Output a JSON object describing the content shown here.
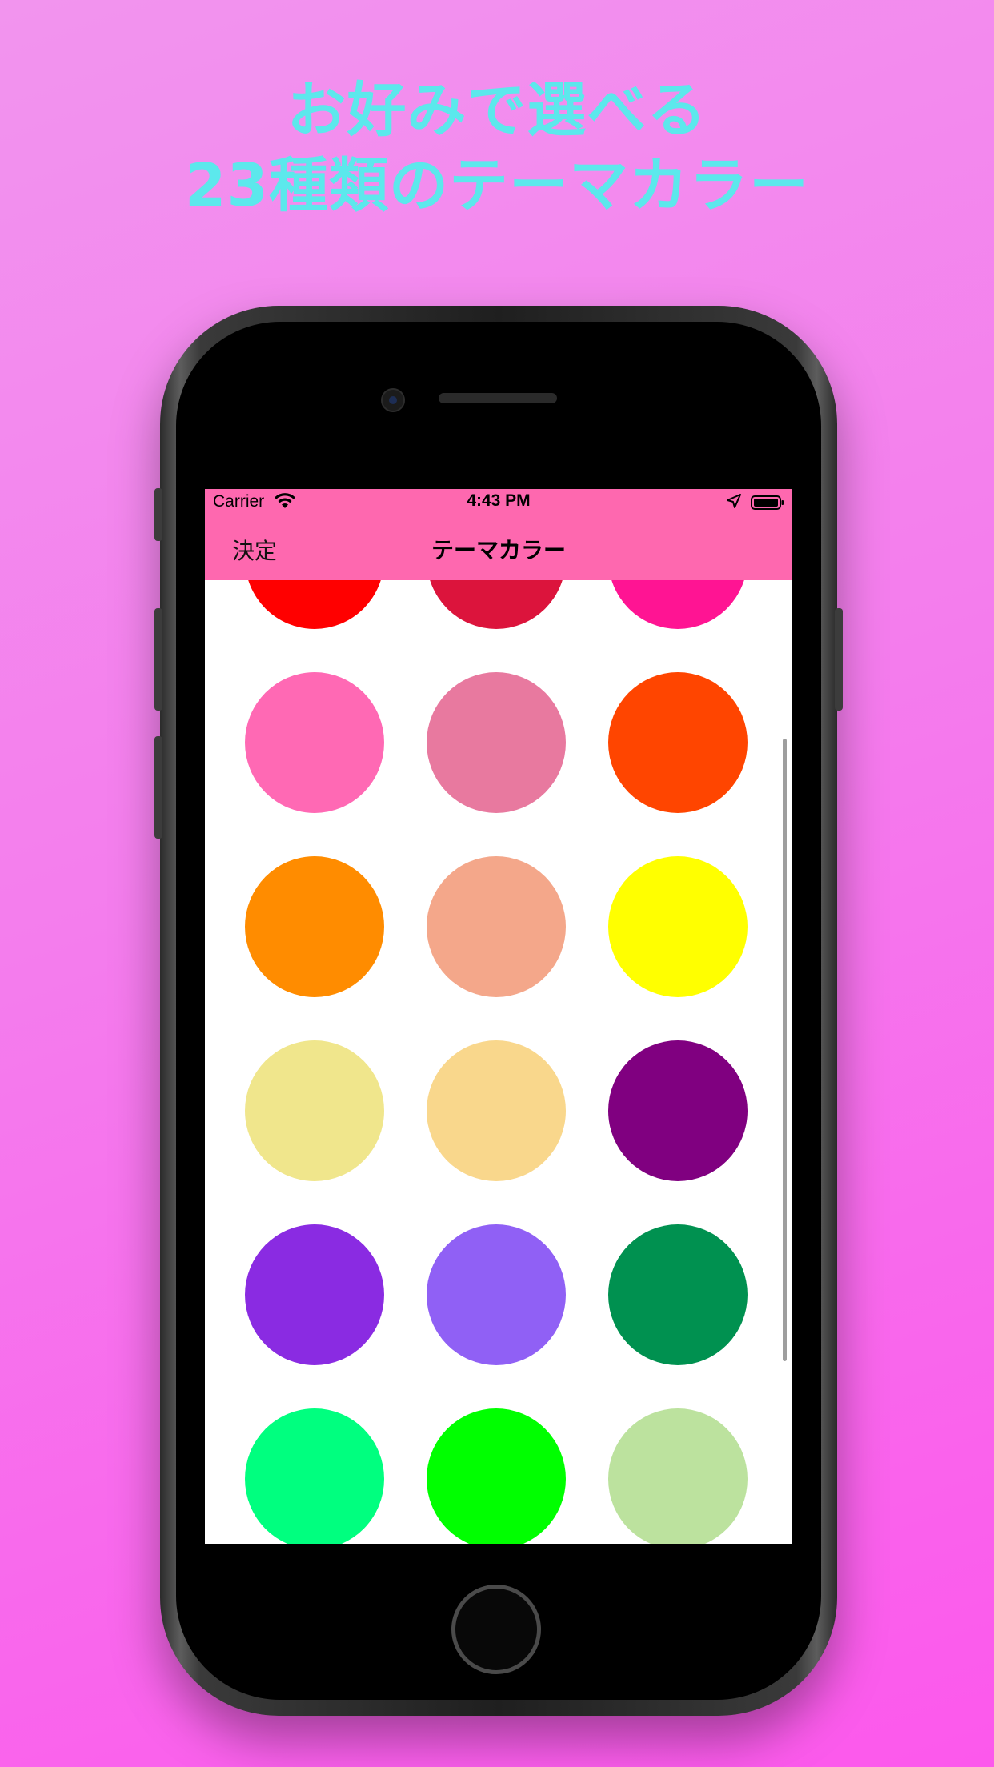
{
  "headline": {
    "line1": "お好みで選べる",
    "line2": "23種類のテーマカラー"
  },
  "status_bar": {
    "carrier": "Carrier",
    "time": "4:43 PM",
    "icons": [
      "wifi-icon",
      "location-icon",
      "battery-icon"
    ]
  },
  "nav": {
    "done_label": "決定",
    "title": "テーマカラー",
    "background": "#fe68af"
  },
  "colors": [
    "#ff0000",
    "#dc143c",
    "#ff1493",
    "#ff69b4",
    "#e8799f",
    "#ff4500",
    "#ff8c00",
    "#f4a78a",
    "#ffff00",
    "#f0e68c",
    "#f9d78c",
    "#800080",
    "#8a2be2",
    "#9060f5",
    "#009150",
    "#00ff7f",
    "#00ff00",
    "#bce29e"
  ],
  "accent": {
    "headline_color": "#5ce8ec"
  }
}
